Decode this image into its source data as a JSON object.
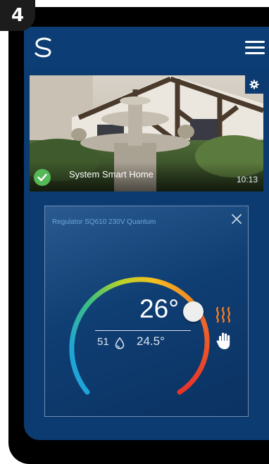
{
  "step": {
    "number": "4"
  },
  "app": {
    "logo_icon": "syxthsense-logo-icon",
    "menu_icon": "hamburger-menu-icon"
  },
  "home": {
    "name": "System Smart Home",
    "time": "10:13",
    "status_icon": "check-circle-icon",
    "settings_icon": "gear-icon"
  },
  "device": {
    "title": "Regulator SQ610 230V Quantum",
    "set_temperature": "26°",
    "humidity": "51",
    "room_temperature": "24.5°",
    "mode_icons": [
      "heating-icon",
      "manual-mode-icon"
    ],
    "close_icon": "close-icon",
    "dial_level": 0.82
  },
  "colors": {
    "screen_bg": "#0b3b70",
    "heating": "#f47a20",
    "check": "#55b958",
    "title_text": "#6fa6e0"
  }
}
